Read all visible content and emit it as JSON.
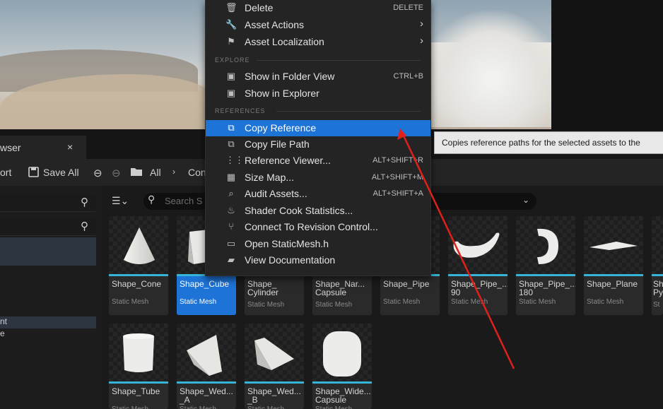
{
  "viewport": {},
  "content_browser": {
    "tab_label": "wser",
    "close_glyph": "×",
    "toolbar": {
      "import_label": "ort",
      "save_all_label": "Save All",
      "all_label": "All",
      "path_label": "Con"
    },
    "search_placeholder": "Search S",
    "left_rows": [
      "nt",
      "e"
    ]
  },
  "assets_row1": [
    {
      "name": "Shape_Cone",
      "type": "Static Mesh"
    },
    {
      "name": "Shape_Cube",
      "type": "Static Mesh"
    },
    {
      "name": "Shape_\nCylinder",
      "type": "Static Mesh"
    },
    {
      "name": "Shape_Nar...\nCapsule",
      "type": "Static Mesh"
    },
    {
      "name": "Shape_Pipe",
      "type": "Static Mesh"
    },
    {
      "name": "Shape_Pipe_...\n90",
      "type": "Static Mesh"
    },
    {
      "name": "Shape_Pipe_...\n180",
      "type": "Static Mesh"
    },
    {
      "name": "Shape_Plane",
      "type": "Static Mesh"
    },
    {
      "name": "Sh\nPy",
      "type": "St"
    }
  ],
  "assets_row2": [
    {
      "name": "Shape_Tube",
      "type": "Static Mesh"
    },
    {
      "name": "Shape_Wed...\n_A",
      "type": "Static Mesh"
    },
    {
      "name": "Shape_Wed...\n_B",
      "type": "Static Mesh"
    },
    {
      "name": "Shape_Wide...\nCapsule",
      "type": "Static Mesh"
    }
  ],
  "context_menu": {
    "items": [
      {
        "label": "Delete",
        "shortcut": "DELETE",
        "icon": "trash-icon"
      },
      {
        "label": "Asset Actions",
        "submenu": true,
        "icon": "wrench-icon"
      },
      {
        "label": "Asset Localization",
        "submenu": true,
        "icon": "flag-icon"
      },
      {
        "label": "Show in Folder View",
        "shortcut": "CTRL+B",
        "icon": "folder-search-icon"
      },
      {
        "label": "Show in Explorer",
        "icon": "folder-search-icon"
      },
      {
        "label": "Copy Reference",
        "icon": "copy-icon",
        "highlighted": true
      },
      {
        "label": "Copy File Path",
        "icon": "copy-icon"
      },
      {
        "label": "Reference Viewer...",
        "shortcut": "ALT+SHIFT+R",
        "icon": "graph-icon"
      },
      {
        "label": "Size Map...",
        "shortcut": "ALT+SHIFT+M",
        "icon": "size-map-icon"
      },
      {
        "label": "Audit Assets...",
        "shortcut": "ALT+SHIFT+A",
        "icon": "audit-icon"
      },
      {
        "label": "Shader Cook Statistics...",
        "icon": "shader-icon"
      },
      {
        "label": "Connect To Revision Control...",
        "icon": "branch-icon"
      },
      {
        "label": "Open StaticMesh.h",
        "icon": "code-file-icon"
      },
      {
        "label": "View Documentation",
        "icon": "book-icon"
      }
    ],
    "sections": {
      "explore": "EXPLORE",
      "references": "REFERENCES"
    }
  },
  "tooltip": "Copies reference paths for the selected assets to the",
  "colors": {
    "highlight": "#1d73d6",
    "accent_bar": "#36b4d8",
    "arrow": "#e0201a"
  }
}
